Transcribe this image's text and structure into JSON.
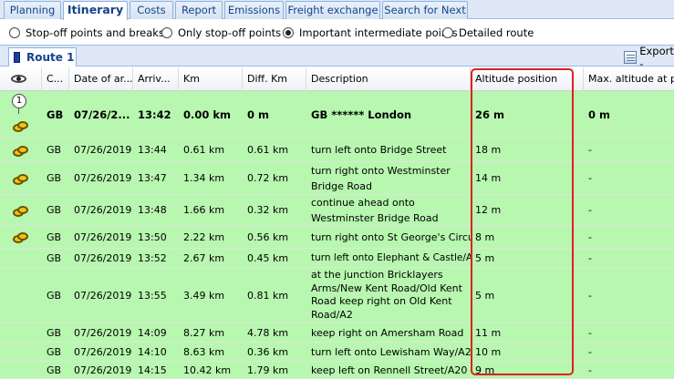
{
  "tabs": [
    {
      "label": "Planning",
      "active": false
    },
    {
      "label": "Itinerary",
      "active": true
    },
    {
      "label": "Costs",
      "active": false
    },
    {
      "label": "Report",
      "active": false
    },
    {
      "label": "Emissions",
      "active": false
    },
    {
      "label": "Freight exchange",
      "active": false
    },
    {
      "label": "Search for Next",
      "active": false
    }
  ],
  "view_options": [
    {
      "label": "Stop-off points and breaks",
      "checked": false
    },
    {
      "label": "Only stop-off points",
      "checked": false
    },
    {
      "label": "Important intermediate points",
      "checked": true
    },
    {
      "label": "Detailed route",
      "checked": false
    }
  ],
  "route_tab": {
    "label": "Route 1"
  },
  "export": {
    "label": "Export -"
  },
  "columns": [
    "C...",
    "Date of ar...",
    "Arriv...",
    "Km",
    "Diff. Km",
    "Description",
    "Altitude position",
    "Max. altitude at prev"
  ],
  "rows": [
    {
      "icon": "start-pin-icon",
      "pin_label": "1",
      "country": "GB",
      "date": "07/26/2...",
      "arrival": "13:42",
      "km": "0.00 km",
      "diff_km": "0 m",
      "description": "GB ****** London",
      "altitude": "26 m",
      "max_altitude": "0 m",
      "bold": true
    },
    {
      "icon": "stop-icon",
      "country": "GB",
      "date": "07/26/2019",
      "arrival": "13:44",
      "km": "0.61 km",
      "diff_km": "0.61 km",
      "description": "turn left onto Bridge Street",
      "altitude": "18 m",
      "max_altitude": "-"
    },
    {
      "icon": "stop-icon",
      "country": "GB",
      "date": "07/26/2019",
      "arrival": "13:47",
      "km": "1.34 km",
      "diff_km": "0.72 km",
      "description": "turn right onto Westminster Bridge Road",
      "altitude": "14 m",
      "max_altitude": "-"
    },
    {
      "icon": "stop-icon",
      "country": "GB",
      "date": "07/26/2019",
      "arrival": "13:48",
      "km": "1.66 km",
      "diff_km": "0.32 km",
      "description": "continue ahead onto Westminster Bridge Road",
      "altitude": "12 m",
      "max_altitude": "-"
    },
    {
      "icon": "stop-icon",
      "country": "GB",
      "date": "07/26/2019",
      "arrival": "13:50",
      "km": "2.22 km",
      "diff_km": "0.56 km",
      "description": "turn right onto St George's Circus",
      "altitude": "8 m",
      "max_altitude": "-"
    },
    {
      "icon": "",
      "country": "GB",
      "date": "07/26/2019",
      "arrival": "13:52",
      "km": "2.67 km",
      "diff_km": "0.45 km",
      "description": "turn left onto Elephant & Castle/A3",
      "altitude": "5 m",
      "max_altitude": "-"
    },
    {
      "icon": "",
      "country": "GB",
      "date": "07/26/2019",
      "arrival": "13:55",
      "km": "3.49 km",
      "diff_km": "0.81 km",
      "description": "at the junction Bricklayers Arms/New Kent Road/Old Kent Road keep right on Old Kent Road/A2",
      "altitude": "5 m",
      "max_altitude": "-"
    },
    {
      "icon": "",
      "country": "GB",
      "date": "07/26/2019",
      "arrival": "14:09",
      "km": "8.27 km",
      "diff_km": "4.78 km",
      "description": "keep right on Amersham Road",
      "altitude": "11 m",
      "max_altitude": "-"
    },
    {
      "icon": "",
      "country": "GB",
      "date": "07/26/2019",
      "arrival": "14:10",
      "km": "8.63 km",
      "diff_km": "0.36 km",
      "description": "turn left onto Lewisham Way/A20",
      "altitude": "10 m",
      "max_altitude": "-"
    },
    {
      "icon": "",
      "country": "GB",
      "date": "07/26/2019",
      "arrival": "14:15",
      "km": "10.42 km",
      "diff_km": "1.79 km",
      "description": "keep left on Rennell Street/A20",
      "altitude": "9 m",
      "max_altitude": "-"
    }
  ],
  "colors": {
    "row_bg": "#b8f7b0",
    "highlight": "#e02020",
    "tab_text": "#15428b"
  }
}
